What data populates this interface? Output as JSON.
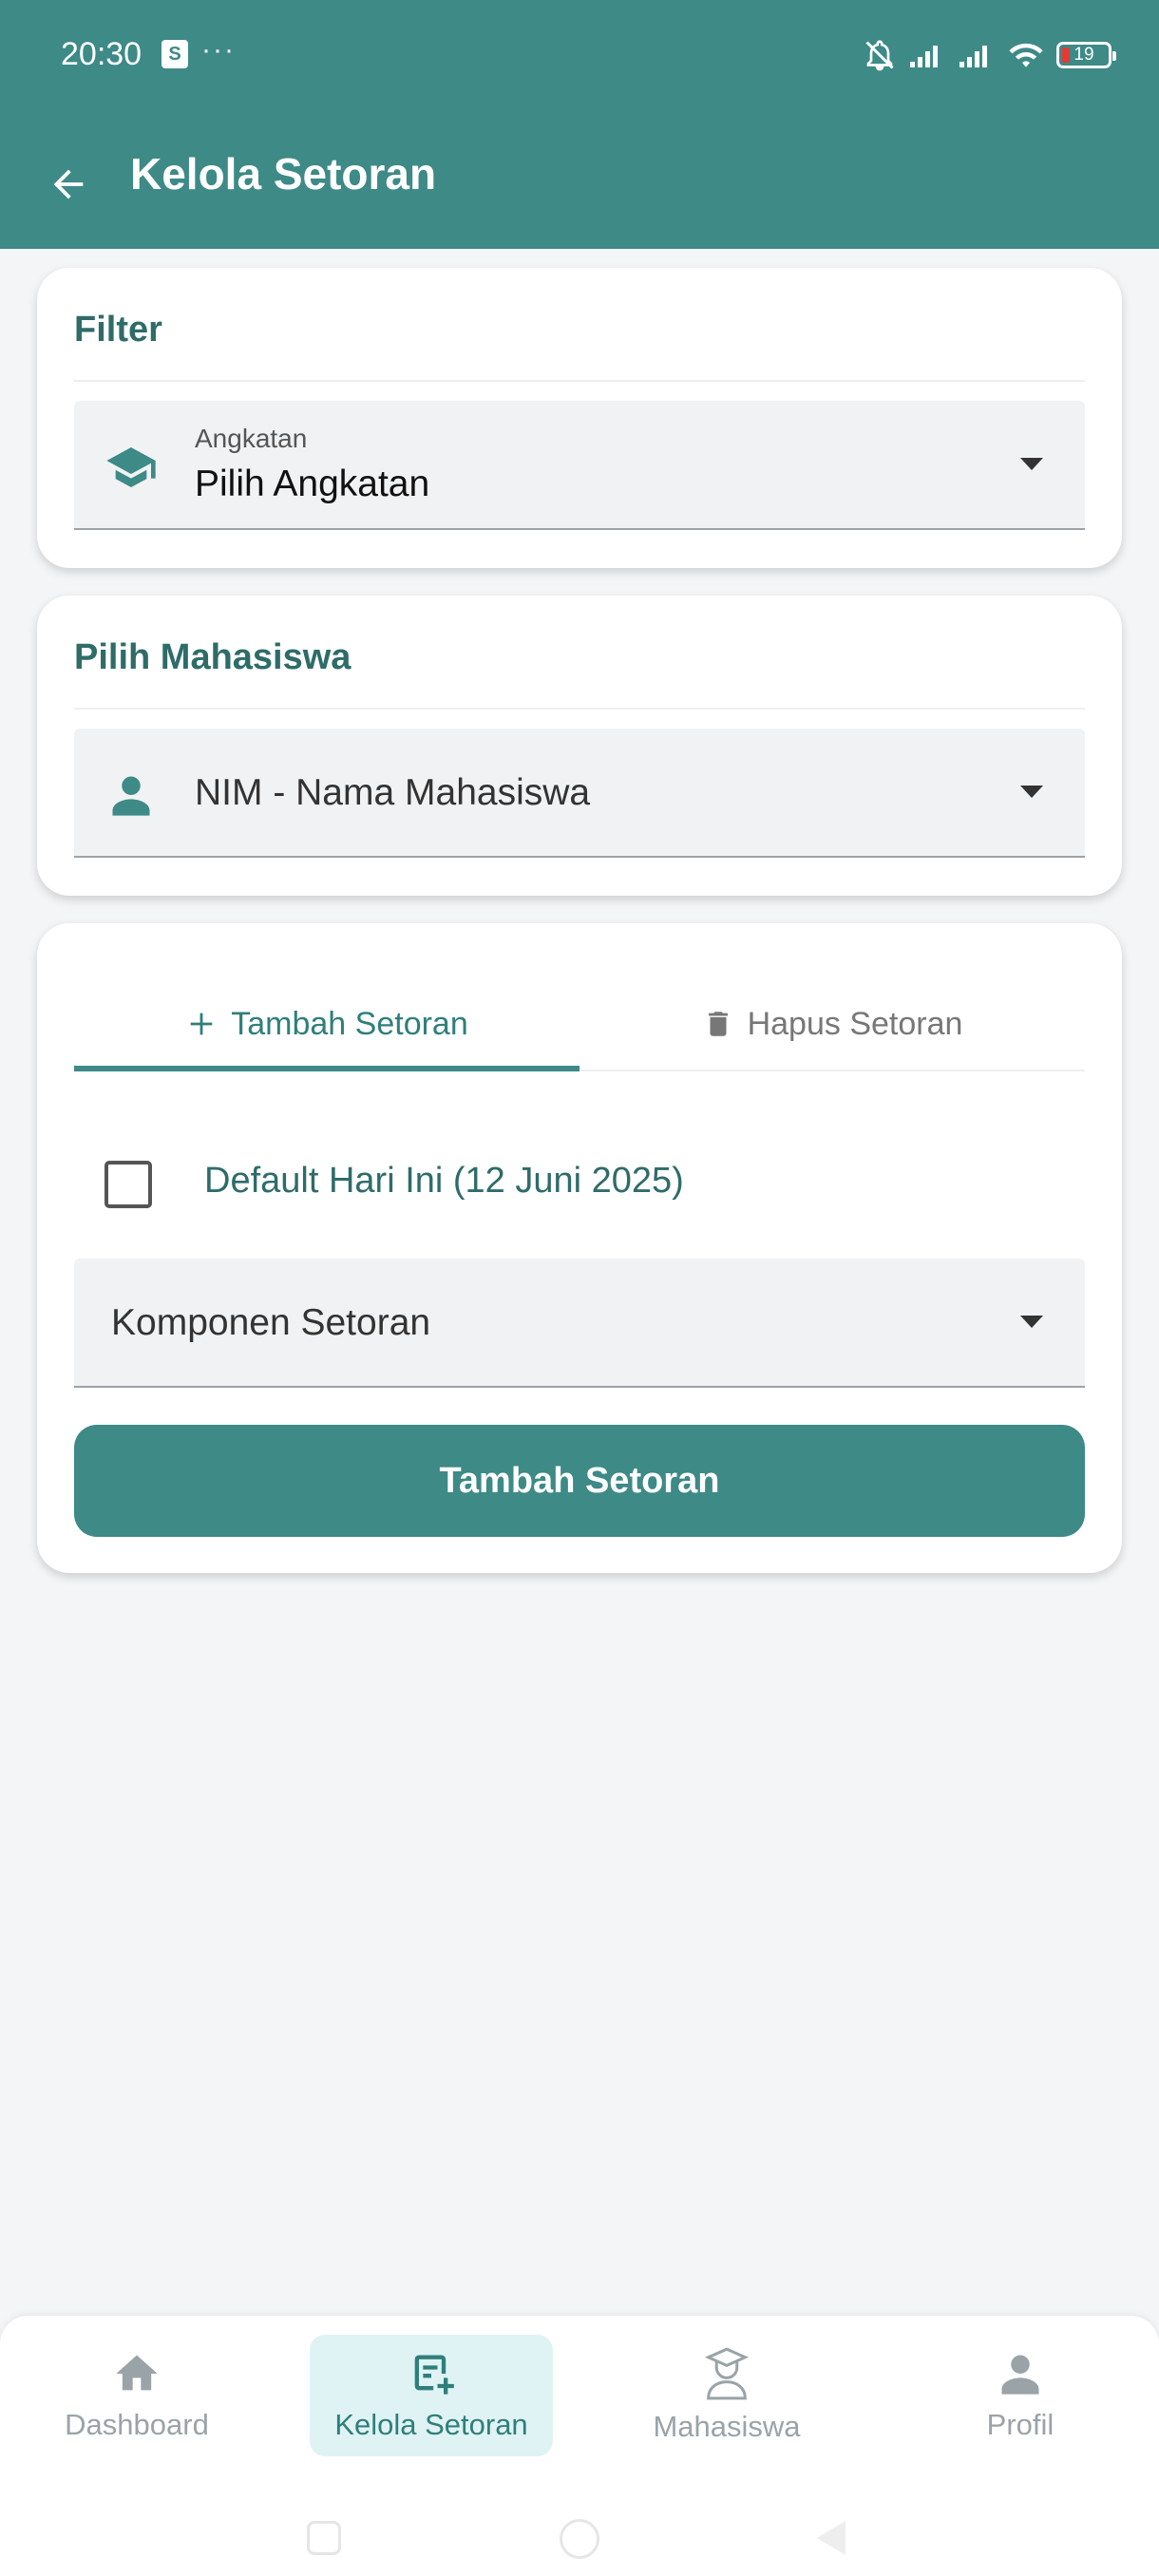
{
  "status_bar": {
    "time": "20:30",
    "battery": "19",
    "dots": "···",
    "bag_glyph": "S"
  },
  "app_bar": {
    "title": "Kelola Setoran"
  },
  "filter_card": {
    "title": "Filter",
    "angkatan_label": "Angkatan",
    "angkatan_value": "Pilih Angkatan"
  },
  "mahasiswa_card": {
    "title": "Pilih Mahasiswa",
    "select_value": "NIM - Nama Mahasiswa"
  },
  "setoran_card": {
    "tabs": [
      {
        "label": "Tambah Setoran",
        "icon": "plus-icon",
        "active": true
      },
      {
        "label": "Hapus Setoran",
        "icon": "trash-icon",
        "active": false
      }
    ],
    "checkbox_label": "Default Hari Ini (12 Juni 2025)",
    "komponen_select": "Komponen Setoran",
    "submit_label": "Tambah Setoran"
  },
  "bottom_nav": {
    "items": [
      {
        "label": "Dashboard",
        "icon": "home-icon"
      },
      {
        "label": "Kelola Setoran",
        "icon": "note-add-icon",
        "active": true
      },
      {
        "label": "Mahasiswa",
        "icon": "student-icon"
      },
      {
        "label": "Profil",
        "icon": "person-icon"
      }
    ]
  },
  "colors": {
    "primary": "#3d8a87",
    "primary_dark": "#2e6c69",
    "active_nav_bg": "#dff3f5",
    "background": "#f4f5f7"
  }
}
